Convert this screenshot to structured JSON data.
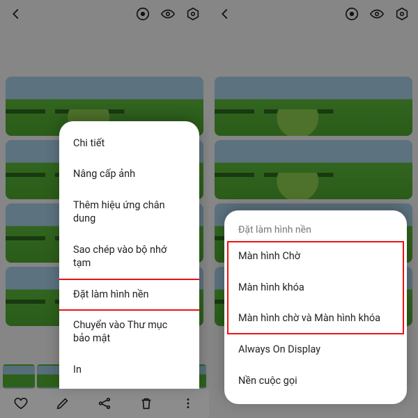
{
  "left": {
    "popup": {
      "items": [
        "Chi tiết",
        "Nâng cấp ảnh",
        "Thêm hiệu ứng chân dung",
        "Sao chép vào bộ nhớ tạm",
        "Đặt làm hình nền",
        "Chuyển vào Thư mục bảo mật",
        "In"
      ],
      "highlight_index": 4
    }
  },
  "right": {
    "popup": {
      "title": "Đặt làm hình nền",
      "items": [
        "Màn hình Chờ",
        "Màn hình khóa",
        "Màn hình chờ và Màn hình khóa",
        "Always On Display",
        "Nền cuộc gọi"
      ],
      "highlight_range": [
        0,
        2
      ]
    }
  }
}
